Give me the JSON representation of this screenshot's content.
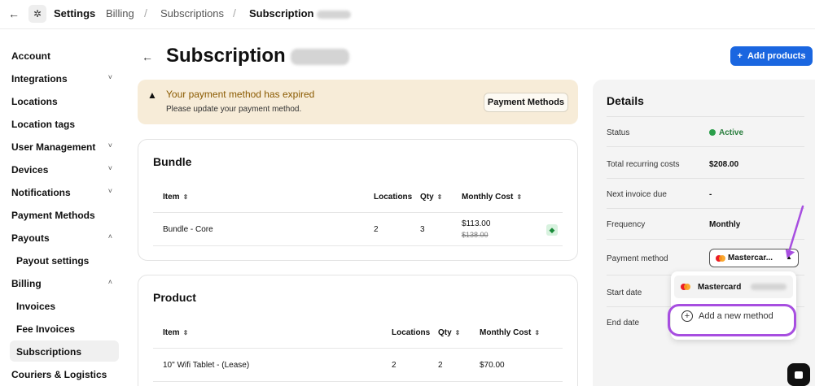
{
  "topbar": {
    "back_icon": "arrow-left-icon",
    "gear_icon": "gear-icon",
    "settings": "Settings",
    "billing": "Billing",
    "subscriptions": "Subscriptions",
    "current": "Subscription",
    "separator": "/"
  },
  "sidebar": {
    "items": [
      {
        "label": "Account"
      },
      {
        "label": "Integrations",
        "chevron": "˅"
      },
      {
        "label": "Locations"
      },
      {
        "label": "Location tags"
      },
      {
        "label": "User Management",
        "chevron": "˅"
      },
      {
        "label": "Devices",
        "chevron": "˅"
      },
      {
        "label": "Notifications",
        "chevron": "˅"
      },
      {
        "label": "Payment Methods"
      },
      {
        "label": "Payouts",
        "chevron": "˄"
      },
      {
        "label": "Payout settings"
      },
      {
        "label": "Billing",
        "chevron": "˄"
      },
      {
        "label": "Invoices"
      },
      {
        "label": "Fee Invoices"
      },
      {
        "label": "Subscriptions"
      },
      {
        "label": "Couriers & Logistics"
      }
    ]
  },
  "main": {
    "title": "Subscription",
    "add_products": "Add products",
    "add_icon": "+",
    "alert": {
      "icon": "warning-icon",
      "title": "Your payment method has expired",
      "message": "Please update your payment method.",
      "button": "Payment Methods"
    },
    "bundle": {
      "title": "Bundle",
      "headers": {
        "item": "Item",
        "locations": "Locations",
        "qty": "Qty",
        "monthly_cost": "Monthly Cost"
      },
      "rows": [
        {
          "item": "Bundle - Core",
          "locations": "2",
          "qty": "3",
          "cost": "$113.00",
          "old_cost": "$138.00"
        }
      ]
    },
    "product": {
      "title": "Product",
      "headers": {
        "item": "Item",
        "locations": "Locations",
        "qty": "Qty",
        "monthly_cost": "Monthly Cost"
      },
      "rows": [
        {
          "item": "10\" Wifi Tablet - (Lease)",
          "locations": "2",
          "qty": "2",
          "cost": "$70.00"
        }
      ]
    }
  },
  "details": {
    "title": "Details",
    "status_label": "Status",
    "status_value": "Active",
    "total_label": "Total recurring costs",
    "total_value": "$208.00",
    "next_invoice_label": "Next invoice due",
    "next_invoice_value": "-",
    "frequency_label": "Frequency",
    "frequency_value": "Monthly",
    "payment_method_label": "Payment method",
    "payment_method_value": "Mastercar...",
    "start_date_label": "Start date",
    "end_date_label": "End date",
    "dropdown": {
      "option_mastercard": "Mastercard",
      "option_add": "Add a new method"
    }
  },
  "colors": {
    "primary": "#1a66e0",
    "alert_bg": "#f7ecd8",
    "active_green": "#2a9e4a",
    "annotation_purple": "#a74ee0"
  }
}
